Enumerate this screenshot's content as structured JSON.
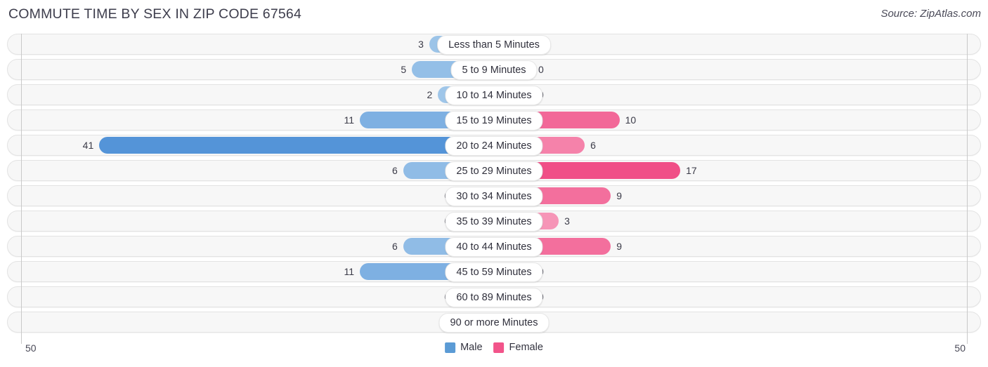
{
  "header": {
    "title": "COMMUTE TIME BY SEX IN ZIP CODE 67564",
    "source": "Source: ZipAtlas.com"
  },
  "axis": {
    "left_tick": "50",
    "right_tick": "50"
  },
  "legend": {
    "items": [
      {
        "label": "Male",
        "color": "#5b9bd5"
      },
      {
        "label": "Female",
        "color": "#f2548a"
      }
    ]
  },
  "chart_data": {
    "type": "bar",
    "orientation": "horizontal-diverging",
    "title": "Commute Time by Sex in Zip Code 67564",
    "xlabel": "",
    "ylabel": "",
    "xlim": [
      50,
      50
    ],
    "axis_max": 50,
    "grid": false,
    "legend_position": "bottom-center",
    "categories": [
      "Less than 5 Minutes",
      "5 to 9 Minutes",
      "10 to 14 Minutes",
      "15 to 19 Minutes",
      "20 to 24 Minutes",
      "25 to 29 Minutes",
      "30 to 34 Minutes",
      "35 to 39 Minutes",
      "40 to 44 Minutes",
      "45 to 59 Minutes",
      "60 to 89 Minutes",
      "90 or more Minutes"
    ],
    "series": [
      {
        "name": "Male",
        "values": [
          3,
          5,
          2,
          11,
          41,
          6,
          0,
          0,
          6,
          11,
          0,
          0
        ]
      },
      {
        "name": "Female",
        "values": [
          0,
          0,
          0,
          10,
          6,
          17,
          9,
          3,
          9,
          0,
          0,
          0
        ]
      }
    ],
    "rows": [
      {
        "label": "Less than 5 Minutes",
        "male": 3,
        "male_text": "3",
        "female": 0,
        "female_text": "0"
      },
      {
        "label": "5 to 9 Minutes",
        "male": 5,
        "male_text": "5",
        "female": 0,
        "female_text": "0"
      },
      {
        "label": "10 to 14 Minutes",
        "male": 2,
        "male_text": "2",
        "female": 0,
        "female_text": "0"
      },
      {
        "label": "15 to 19 Minutes",
        "male": 11,
        "male_text": "11",
        "female": 10,
        "female_text": "10"
      },
      {
        "label": "20 to 24 Minutes",
        "male": 41,
        "male_text": "41",
        "female": 6,
        "female_text": "6"
      },
      {
        "label": "25 to 29 Minutes",
        "male": 6,
        "male_text": "6",
        "female": 17,
        "female_text": "17"
      },
      {
        "label": "30 to 34 Minutes",
        "male": 0,
        "male_text": "0",
        "female": 9,
        "female_text": "9"
      },
      {
        "label": "35 to 39 Minutes",
        "male": 0,
        "male_text": "0",
        "female": 3,
        "female_text": "3"
      },
      {
        "label": "40 to 44 Minutes",
        "male": 6,
        "male_text": "6",
        "female": 9,
        "female_text": "9"
      },
      {
        "label": "45 to 59 Minutes",
        "male": 11,
        "male_text": "11",
        "female": 0,
        "female_text": "0"
      },
      {
        "label": "60 to 89 Minutes",
        "male": 0,
        "male_text": "0",
        "female": 0,
        "female_text": "0"
      },
      {
        "label": "90 or more Minutes",
        "male": 0,
        "male_text": "0",
        "female": 0,
        "female_text": "0"
      }
    ]
  }
}
